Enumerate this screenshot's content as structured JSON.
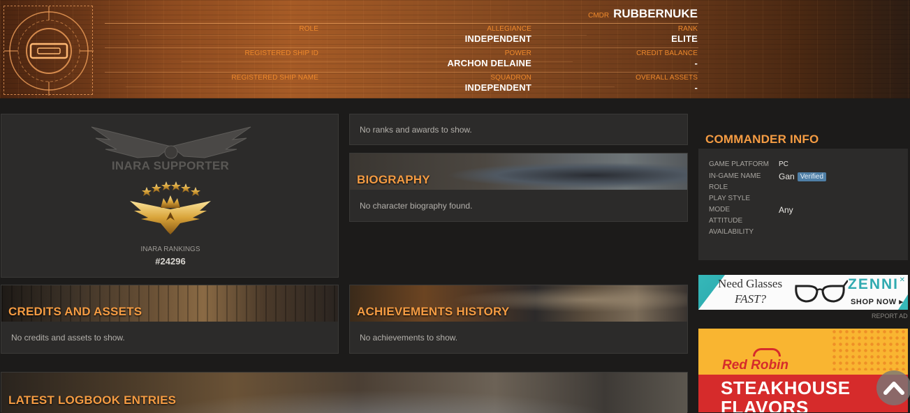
{
  "header": {
    "cmdr_prefix": "CMDR",
    "cmdr_name": "RUBBERNUKE",
    "fields": {
      "role_label": "ROLE",
      "role_value": "",
      "reg_ship_id_label": "REGISTERED SHIP ID",
      "reg_ship_id_value": "",
      "reg_ship_name_label": "REGISTERED SHIP NAME",
      "reg_ship_name_value": "",
      "allegiance_label": "ALLEGIANCE",
      "allegiance_value": "INDEPENDENT",
      "power_label": "POWER",
      "power_value": "ARCHON DELAINE",
      "squadron_label": "SQUADRON",
      "squadron_value": "INDEPENDENT",
      "rank_label": "RANK",
      "rank_value": "ELITE",
      "credit_balance_label": "CREDIT BALANCE",
      "credit_balance_value": "-",
      "overall_assets_label": "OVERALL ASSETS",
      "overall_assets_value": "-"
    }
  },
  "supporter": {
    "title": "INARA SUPPORTER",
    "rankings_label": "INARA RANKINGS",
    "rankings_value": "#24296"
  },
  "ranks": {
    "empty_text": "No ranks and awards to show."
  },
  "biography": {
    "title": "BIOGRAPHY",
    "empty_text": "No character biography found."
  },
  "credits": {
    "title": "CREDITS AND ASSETS",
    "empty_text": "No credits and assets to show."
  },
  "achievements": {
    "title": "ACHIEVEMENTS HISTORY",
    "empty_text": "No achievements to show."
  },
  "logbook": {
    "title": "LATEST LOGBOOK ENTRIES"
  },
  "commander_info": {
    "title": "COMMANDER INFO",
    "rows": [
      {
        "label": "GAME PLATFORM",
        "value": "PC"
      },
      {
        "label": "IN-GAME NAME",
        "value": "Gan",
        "badge": "Verified"
      },
      {
        "label": "ROLE",
        "value": ""
      },
      {
        "label": "PLAY STYLE",
        "value": ""
      },
      {
        "label": "MODE",
        "value": "Any"
      },
      {
        "label": "ATTITUDE",
        "value": ""
      },
      {
        "label": "AVAILABILITY",
        "value": ""
      }
    ]
  },
  "ads": {
    "ad1": {
      "line1": "Need Glasses",
      "line2": "FAST?",
      "brand": "ZENNI",
      "cta": "SHOP NOW ▸"
    },
    "report_ad": "REPORT AD",
    "ad2": {
      "brand": "Red Robin",
      "line1": "STEAKHOUSE",
      "line2": "FLAVORS"
    }
  },
  "colors": {
    "accent": "#f59c43",
    "label_orange": "#f08a2c",
    "panel_bg": "#2c2b2a",
    "page_bg": "#1c1b1a",
    "verified_badge": "#4f7fa6"
  },
  "icons": {
    "scroll_top": "chevron-up-icon",
    "emblem": "inara-emblem-icon"
  }
}
